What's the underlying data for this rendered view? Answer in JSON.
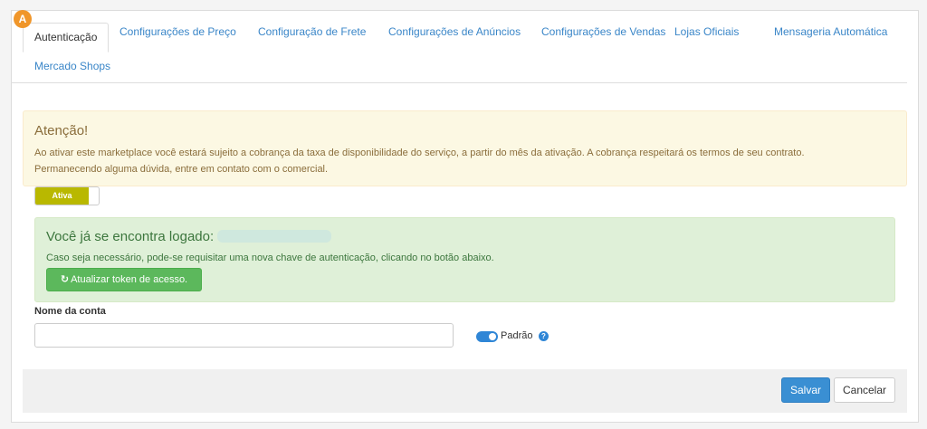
{
  "badge": {
    "letter": "A",
    "color": "#f0962a"
  },
  "tabs": [
    {
      "label": "Autenticação",
      "active": true
    },
    {
      "label": "Configurações de Preço"
    },
    {
      "label": "Configuração de Frete"
    },
    {
      "label": "Configurações de Anúncios"
    },
    {
      "label": "Configurações de Vendas"
    },
    {
      "label": "Lojas Oficiais"
    },
    {
      "label": "Mensageria Automática"
    },
    {
      "label": "Mercado Shops"
    }
  ],
  "warning": {
    "title": "Atenção!",
    "line1": "Ao ativar este marketplace você estará sujeito a cobrança da taxa de disponibilidade do serviço, a partir do mês da ativação. A cobrança respeitará os termos de seu contrato.",
    "line2": "Permanecendo alguma dúvida, entre em contato com o comercial."
  },
  "status_switch": {
    "label": "Ativa",
    "on": true
  },
  "login_box": {
    "title": "Você já se encontra logado:",
    "text": "Caso seja necessário, pode-se requisitar uma nova chave de autenticação, clicando no botão abaixo.",
    "button_label": "Atualizar token de acesso.",
    "button_icon": "refresh-icon"
  },
  "account": {
    "label": "Nome da conta",
    "value": "",
    "default_toggle_label": "Padrão",
    "default_on": true
  },
  "footer": {
    "save_label": "Salvar",
    "cancel_label": "Cancelar"
  },
  "colors": {
    "primary": "#3a8fd3",
    "success": "#5cb85c",
    "warning_bg": "#fcf8e3",
    "switch_on": "#b9b800"
  }
}
